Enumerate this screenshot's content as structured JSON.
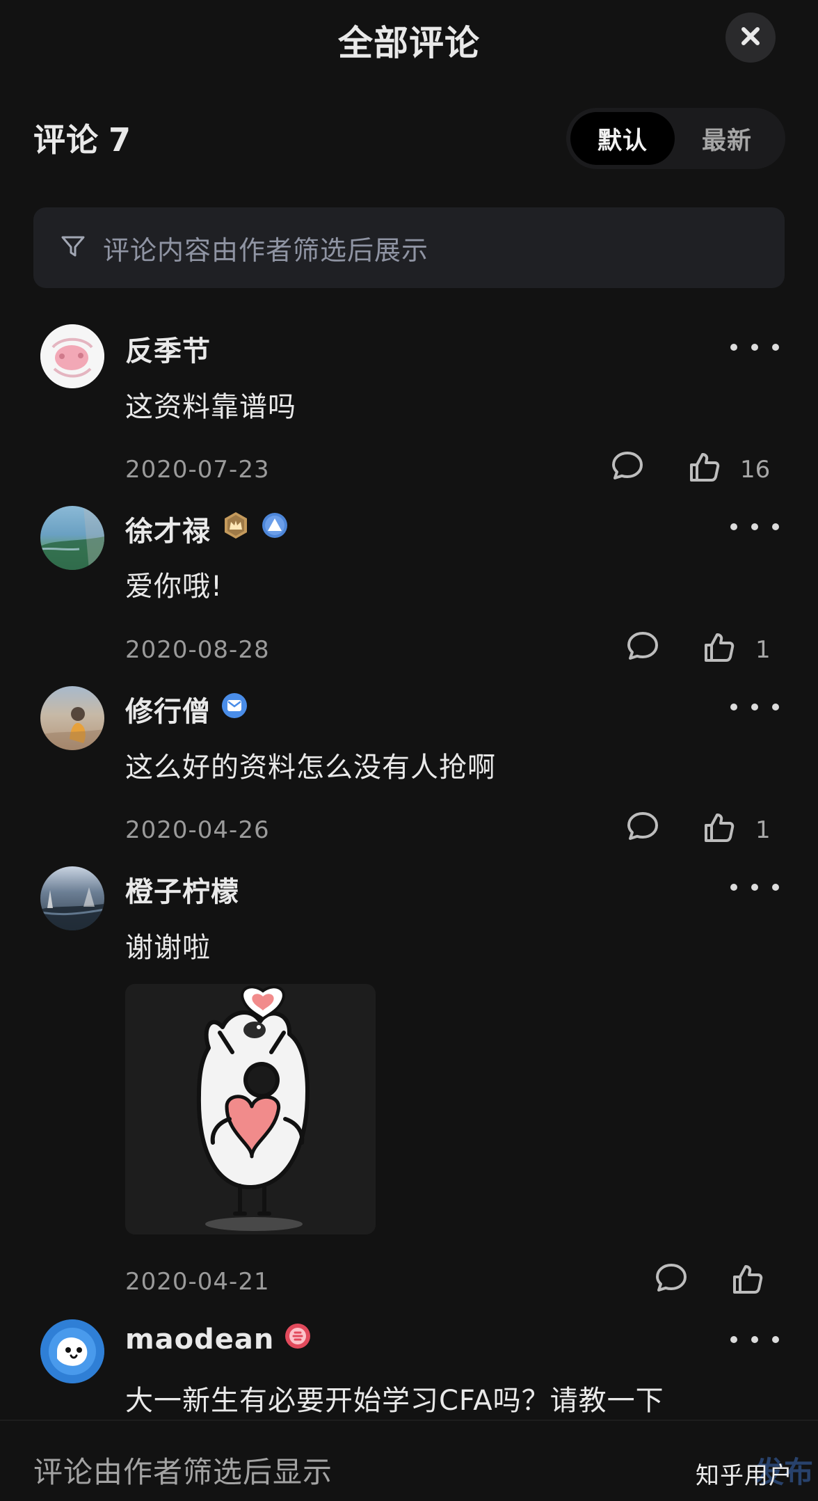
{
  "header": {
    "title": "全部评论",
    "close_icon": "close-icon"
  },
  "comments_section": {
    "label": "评论",
    "count": "7"
  },
  "sort": {
    "options": [
      {
        "label": "默认",
        "active": true
      },
      {
        "label": "最新",
        "active": false
      }
    ]
  },
  "filter_banner": {
    "icon": "filter-icon",
    "text": "评论内容由作者筛选后展示"
  },
  "comments": [
    {
      "author": "反季节",
      "content": "这资料靠谱吗",
      "date": "2020-07-23",
      "likes": "16",
      "badges": []
    },
    {
      "author": "徐才禄",
      "content": "爱你哦!",
      "date": "2020-08-28",
      "likes": "1",
      "badges": [
        "crown-badge-icon",
        "level-badge-icon"
      ]
    },
    {
      "author": "修行僧",
      "content": "这么好的资料怎么没有人抢啊",
      "date": "2020-04-26",
      "likes": "1",
      "badges": [
        "verified-mail-badge-icon"
      ]
    },
    {
      "author": "橙子柠檬",
      "content": "谢谢啦",
      "date": "2020-04-21",
      "likes": "",
      "badges": [],
      "has_image": true
    },
    {
      "author": "maodean",
      "content": "大一新生有必要开始学习CFA吗？请教一下",
      "date": "",
      "likes": "",
      "badges": [
        "red-badge-icon"
      ]
    }
  ],
  "bottom_bar": {
    "placeholder": "评论由作者筛选后显示",
    "send_label": "发布"
  },
  "watermark": {
    "text": "知乎用户"
  },
  "colors": {
    "background": "#121212",
    "panel": "#1f2024",
    "muted": "#9a9a9a",
    "link_blue": "#3a6ab6"
  }
}
